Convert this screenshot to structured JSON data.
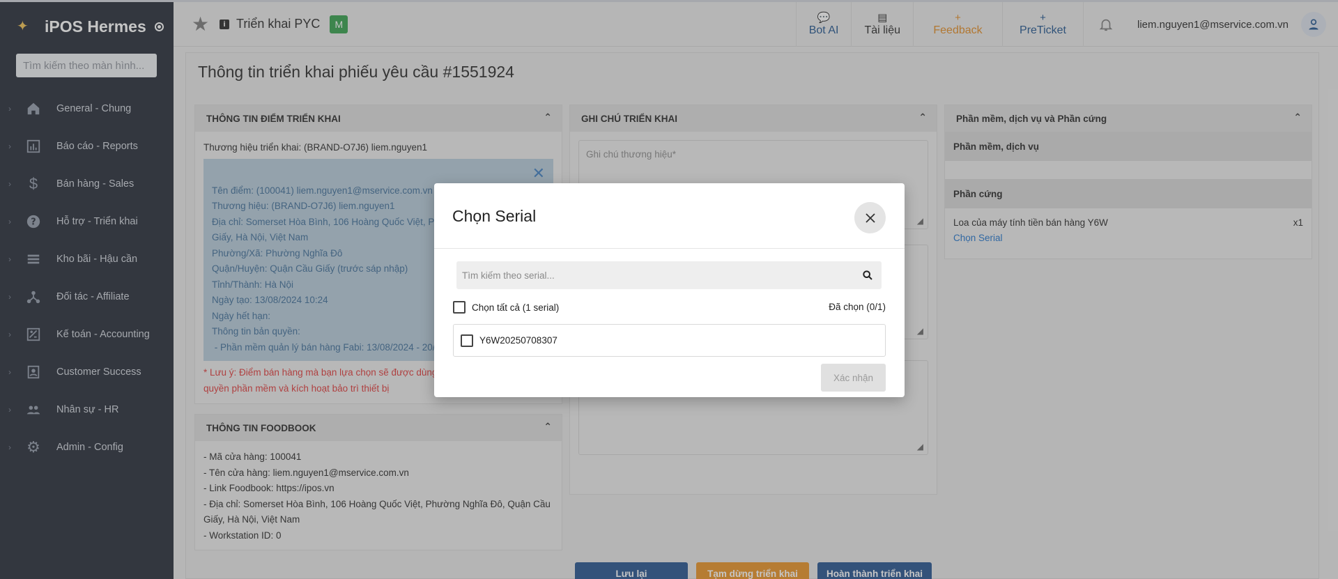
{
  "sidebar": {
    "brand": "iPOS Hermes",
    "search_placeholder": "Tìm kiếm theo màn hình...",
    "items": [
      {
        "label": "General - Chung",
        "icon": "home-icon"
      },
      {
        "label": "Báo cáo - Reports",
        "icon": "chart-icon"
      },
      {
        "label": "Bán hàng - Sales",
        "icon": "dollar-icon"
      },
      {
        "label": "Hỗ trợ - Triển khai",
        "icon": "help-icon"
      },
      {
        "label": "Kho bãi - Hậu cần",
        "icon": "list-icon"
      },
      {
        "label": "Đối tác - Affiliate",
        "icon": "network-icon"
      },
      {
        "label": "Kế toán - Accounting",
        "icon": "accounting-icon"
      },
      {
        "label": "Customer Success",
        "icon": "contact-icon"
      },
      {
        "label": "Nhân sự - HR",
        "icon": "people-icon"
      },
      {
        "label": "Admin - Config",
        "icon": "gear-icon"
      }
    ]
  },
  "topbar": {
    "title": "Triển khai PYC",
    "badge": "M",
    "bot_ai": "Bot AI",
    "docs": "Tài liệu",
    "feedback": "Feedback",
    "preticket": "PreTicket",
    "user_email": "liem.nguyen1@mservice.com.vn"
  },
  "page": {
    "title": "Thông tin triển khai phiếu yêu cầu #1551924"
  },
  "deploy_info": {
    "header": "THÔNG TIN ĐIỂM TRIỂN KHAI",
    "brand_line": "Thương hiệu triển khai: (BRAND-O7J6) liem.nguyen1",
    "lines": [
      "Tên điểm: (100041) liem.nguyen1@mservice.com.vn",
      "Thương hiệu: (BRAND-O7J6) liem.nguyen1",
      "Địa chỉ: Somerset Hòa Bình, 106 Hoàng Quốc Việt, Phư",
      "Giấy, Hà Nội, Việt Nam",
      "Phường/Xã: Phường Nghĩa Đô",
      "Quận/Huyện: Quận Cầu Giấy (trước sáp nhập)",
      "Tỉnh/Thành: Hà Nội",
      "Ngày tạo: 13/08/2024 10:24",
      "Ngày hết hạn:",
      "Thông tin bản quyền:",
      " - Phần mềm quản lý bán hàng Fabi: 13/08/2024 - 20/"
    ],
    "warning_1": "* Lưu ý: Điểm bán hàng mà bạn lựa chọn sẽ được dùng",
    "warning_2": "quyền phần mềm và kích hoạt bảo trì thiết bị"
  },
  "foodbook": {
    "header": "THÔNG TIN FOODBOOK",
    "lines": [
      "- Mã cửa hàng: 100041",
      "- Tên cửa hàng: liem.nguyen1@mservice.com.vn",
      "- Link Foodbook: https://ipos.vn",
      "- Địa chỉ: Somerset Hòa Bình, 106 Hoàng Quốc Việt, Phường Nghĩa Đô, Quận Cầu",
      "Giấy, Hà Nội, Việt Nam",
      "- Workstation ID: 0"
    ]
  },
  "notes": {
    "header": "GHI CHÚ TRIỂN KHAI",
    "brand_note_placeholder": "Ghi chú thương hiệu*"
  },
  "hardware": {
    "header": "Phần mềm, dịch vụ và Phần cứng",
    "software_section": "Phần mềm, dịch vụ",
    "hardware_section": "Phần cứng",
    "item_name": "Loa của máy tính tiền bán hàng Y6W",
    "item_qty": "x1",
    "choose_serial": "Chọn Serial"
  },
  "actions": {
    "save": "Lưu lại",
    "pause": "Tạm dừng triển khai",
    "complete": "Hoàn thành triển khai"
  },
  "modal": {
    "title": "Chọn Serial",
    "search_placeholder": "Tìm kiếm theo serial...",
    "select_all": "Chọn tất cả (1 serial)",
    "chosen": "Đã chọn (0/1)",
    "serials": [
      "Y6W20250708307"
    ],
    "confirm": "Xác nhận"
  },
  "colors": {
    "sidebar_bg": "#1f2532",
    "save_btn": "#1f4f8c",
    "pause_btn": "#e8901f",
    "complete_btn": "#1f4f8c",
    "feedback": "#e0871d"
  }
}
